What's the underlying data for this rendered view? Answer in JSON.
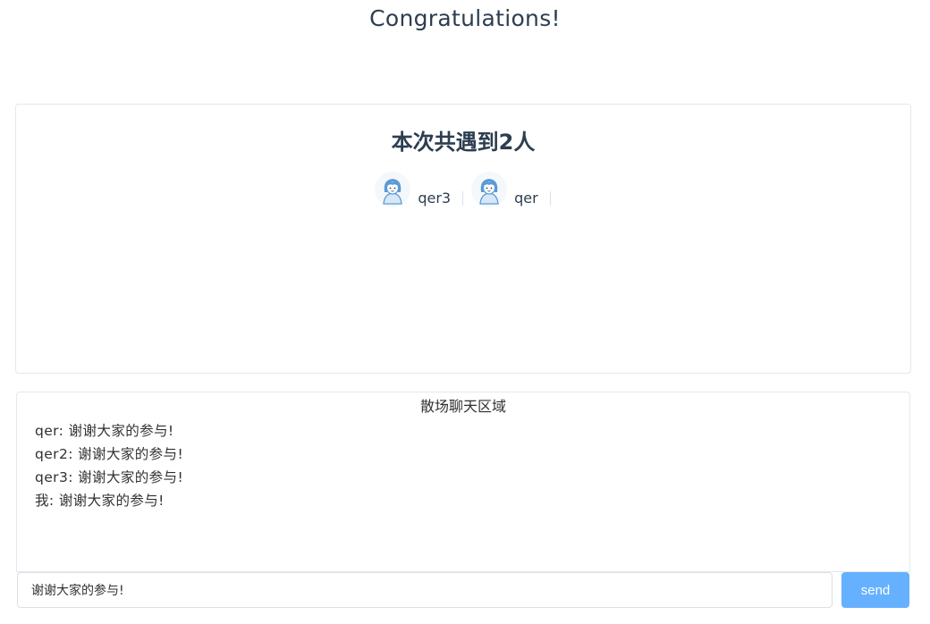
{
  "page": {
    "title": "Congratulations!"
  },
  "summary": {
    "heading": "本次共遇到2人",
    "people": [
      {
        "name": "qer3",
        "avatar_icon": "girl-avatar-icon"
      },
      {
        "name": "qer",
        "avatar_icon": "girl-avatar-icon"
      }
    ]
  },
  "chat": {
    "title": "散场聊天区域",
    "messages": [
      "qer: 谢谢大家的参与!",
      "qer2: 谢谢大家的参与!",
      "qer3: 谢谢大家的参与!",
      "我: 谢谢大家的参与!"
    ],
    "input_value": "谢谢大家的参与!",
    "send_label": "send"
  },
  "colors": {
    "text": "#2c3e50",
    "border": "#e4e7ed",
    "send_button": "#66b1ff",
    "avatar_accent": "#5b9bd5"
  }
}
